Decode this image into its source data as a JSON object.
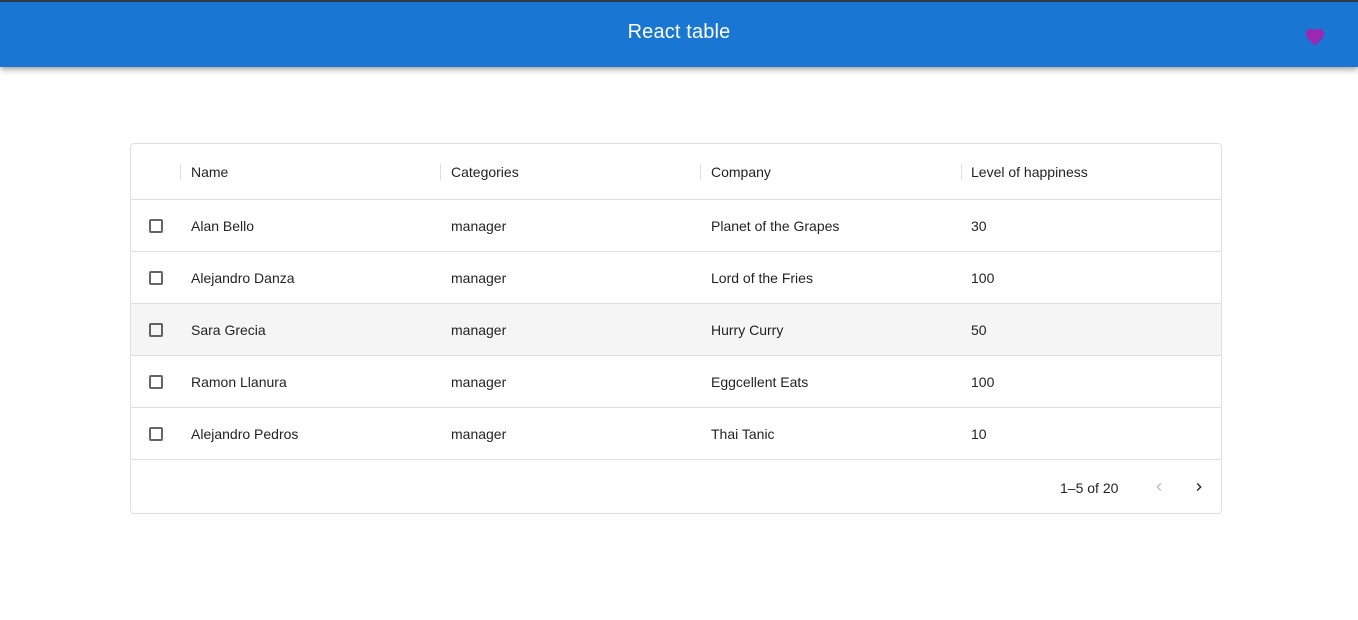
{
  "appbar": {
    "title": "React table",
    "favorite_icon": "heart-icon",
    "background": "#1976d2",
    "heart_color": "#9c27b0"
  },
  "table": {
    "columns": [
      "Name",
      "Categories",
      "Company",
      "Level of happiness"
    ],
    "rows": [
      {
        "name": "Alan Bello",
        "category": "manager",
        "company": "Planet of the Grapes",
        "happiness": "30"
      },
      {
        "name": "Alejandro Danza",
        "category": "manager",
        "company": "Lord of the Fries",
        "happiness": "100"
      },
      {
        "name": "Sara Grecia",
        "category": "manager",
        "company": "Hurry Curry",
        "happiness": "50"
      },
      {
        "name": "Ramon Llanura",
        "category": "manager",
        "company": "Eggcellent Eats",
        "happiness": "100"
      },
      {
        "name": "Alejandro Pedros",
        "category": "manager",
        "company": "Thai Tanic",
        "happiness": "10"
      }
    ],
    "hovered_row": 2
  },
  "pagination": {
    "range_label": "1–5 of 20",
    "prev_icon": "chevron-left-icon",
    "next_icon": "chevron-right-icon",
    "prev_disabled": true
  }
}
